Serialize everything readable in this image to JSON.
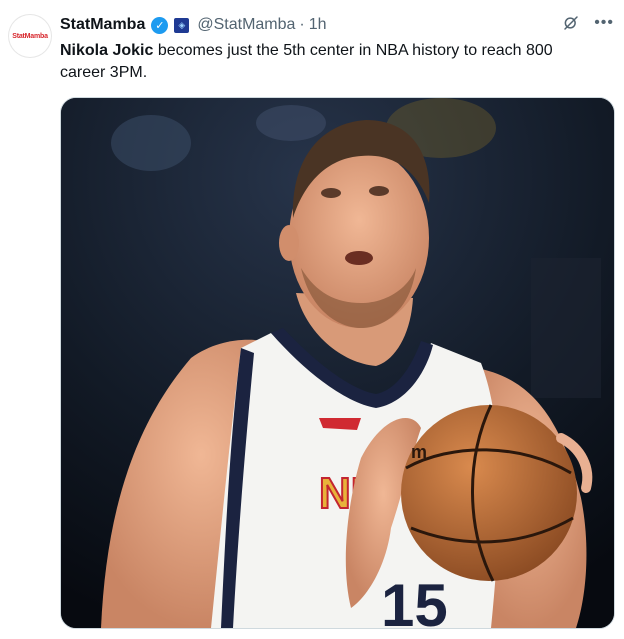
{
  "tweet": {
    "avatar_text": "StatMamba",
    "author_name": "StatMamba",
    "verified_icon": "verified-badge-icon",
    "affiliate_icon": "affiliate-badge-icon",
    "handle": "@StatMamba",
    "separator": "·",
    "time": "1h",
    "text_bold": "Nikola Jokic",
    "text_rest": " becomes just the 5th center in NBA history to reach 800 career 3PM.",
    "media_icon": "photo-basketball-player"
  }
}
